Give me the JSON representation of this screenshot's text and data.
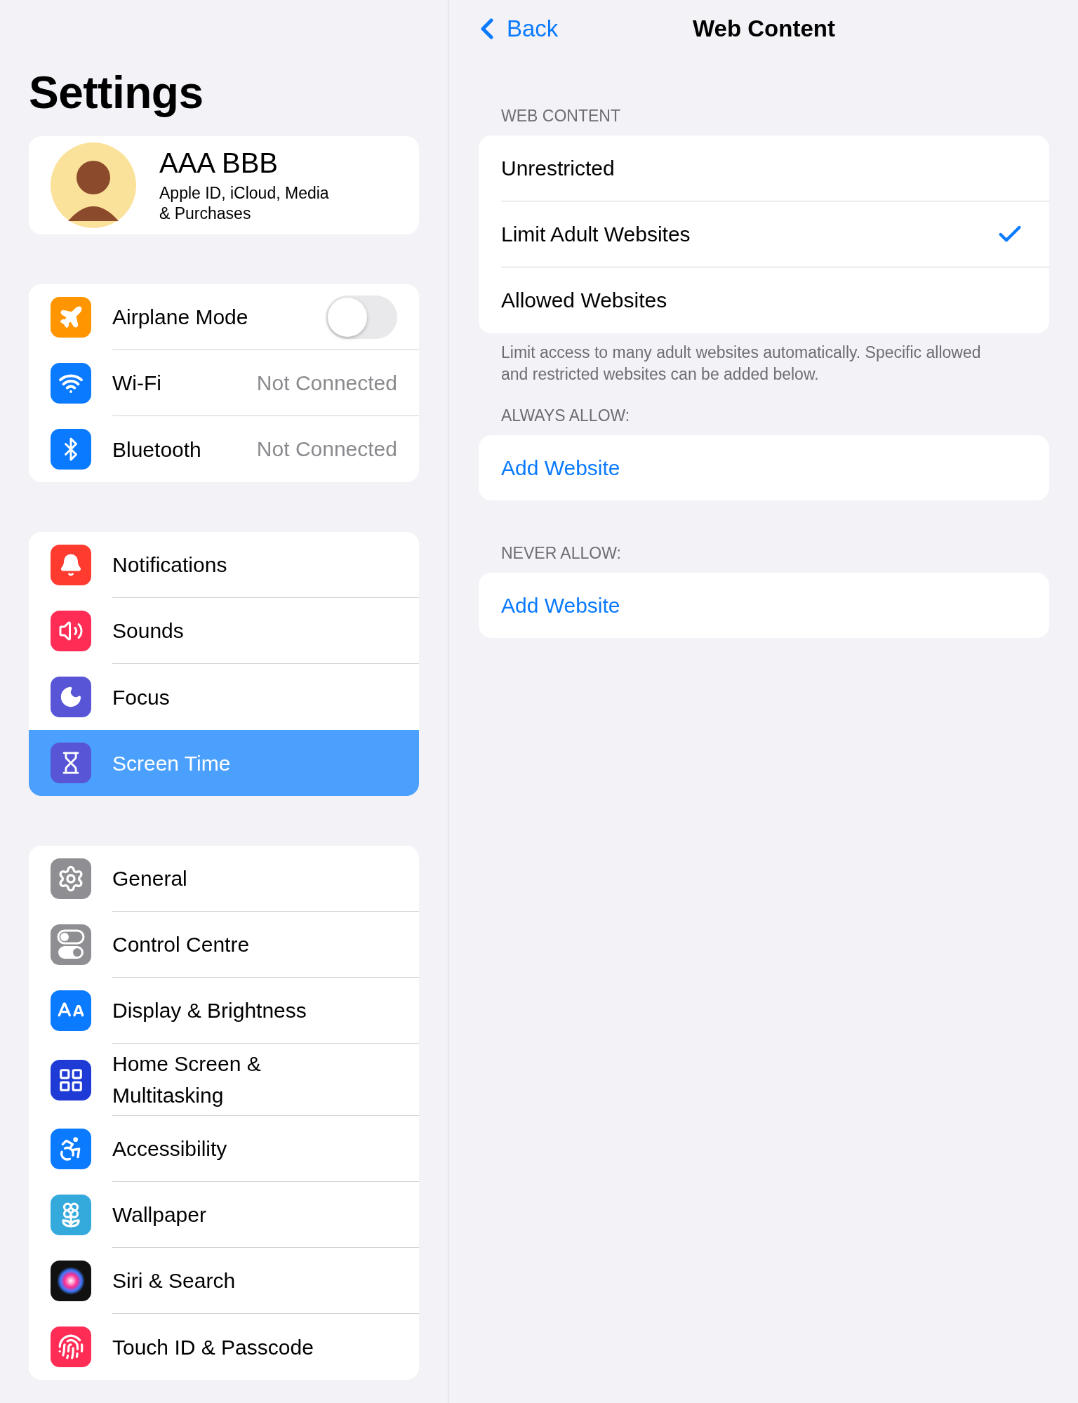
{
  "sidebar": {
    "title": "Settings",
    "profile": {
      "name": "AAA BBB",
      "subtitle": "Apple ID, iCloud, Media\n& Purchases"
    },
    "groups": [
      {
        "items": [
          {
            "label": "Airplane Mode",
            "kind": "toggle",
            "on": false,
            "selected": false
          },
          {
            "label": "Wi-Fi",
            "kind": "value",
            "value": "Not Connected",
            "selected": false
          },
          {
            "label": "Bluetooth",
            "kind": "value",
            "value": "Not Connected",
            "selected": false
          }
        ]
      },
      {
        "items": [
          {
            "label": "Notifications",
            "kind": "plain",
            "selected": false
          },
          {
            "label": "Sounds",
            "kind": "plain",
            "selected": false
          },
          {
            "label": "Focus",
            "kind": "plain",
            "selected": false
          },
          {
            "label": "Screen Time",
            "kind": "plain",
            "selected": true
          }
        ]
      },
      {
        "items": [
          {
            "label": "General",
            "kind": "plain",
            "selected": false
          },
          {
            "label": "Control Centre",
            "kind": "plain",
            "selected": false
          },
          {
            "label": "Display & Brightness",
            "kind": "plain",
            "selected": false
          },
          {
            "label": "Home Screen &\nMultitasking",
            "kind": "plain",
            "selected": false
          },
          {
            "label": "Accessibility",
            "kind": "plain",
            "selected": false
          },
          {
            "label": "Wallpaper",
            "kind": "plain",
            "selected": false
          },
          {
            "label": "Siri & Search",
            "kind": "plain",
            "selected": false
          },
          {
            "label": "Touch ID & Passcode",
            "kind": "plain",
            "selected": false
          }
        ]
      }
    ]
  },
  "detail": {
    "back": "Back",
    "title": "Web Content",
    "section_header": "WEB CONTENT",
    "options": [
      {
        "label": "Unrestricted",
        "selected": false
      },
      {
        "label": "Limit Adult Websites",
        "selected": true
      },
      {
        "label": "Allowed Websites",
        "selected": false
      }
    ],
    "footer": "Limit access to many adult websites automatically. Specific allowed and restricted websites can be added below.",
    "lists": [
      {
        "header": "ALWAYS ALLOW:",
        "action": "Add Website"
      },
      {
        "header": "NEVER ALLOW:",
        "action": "Add Website"
      }
    ]
  }
}
